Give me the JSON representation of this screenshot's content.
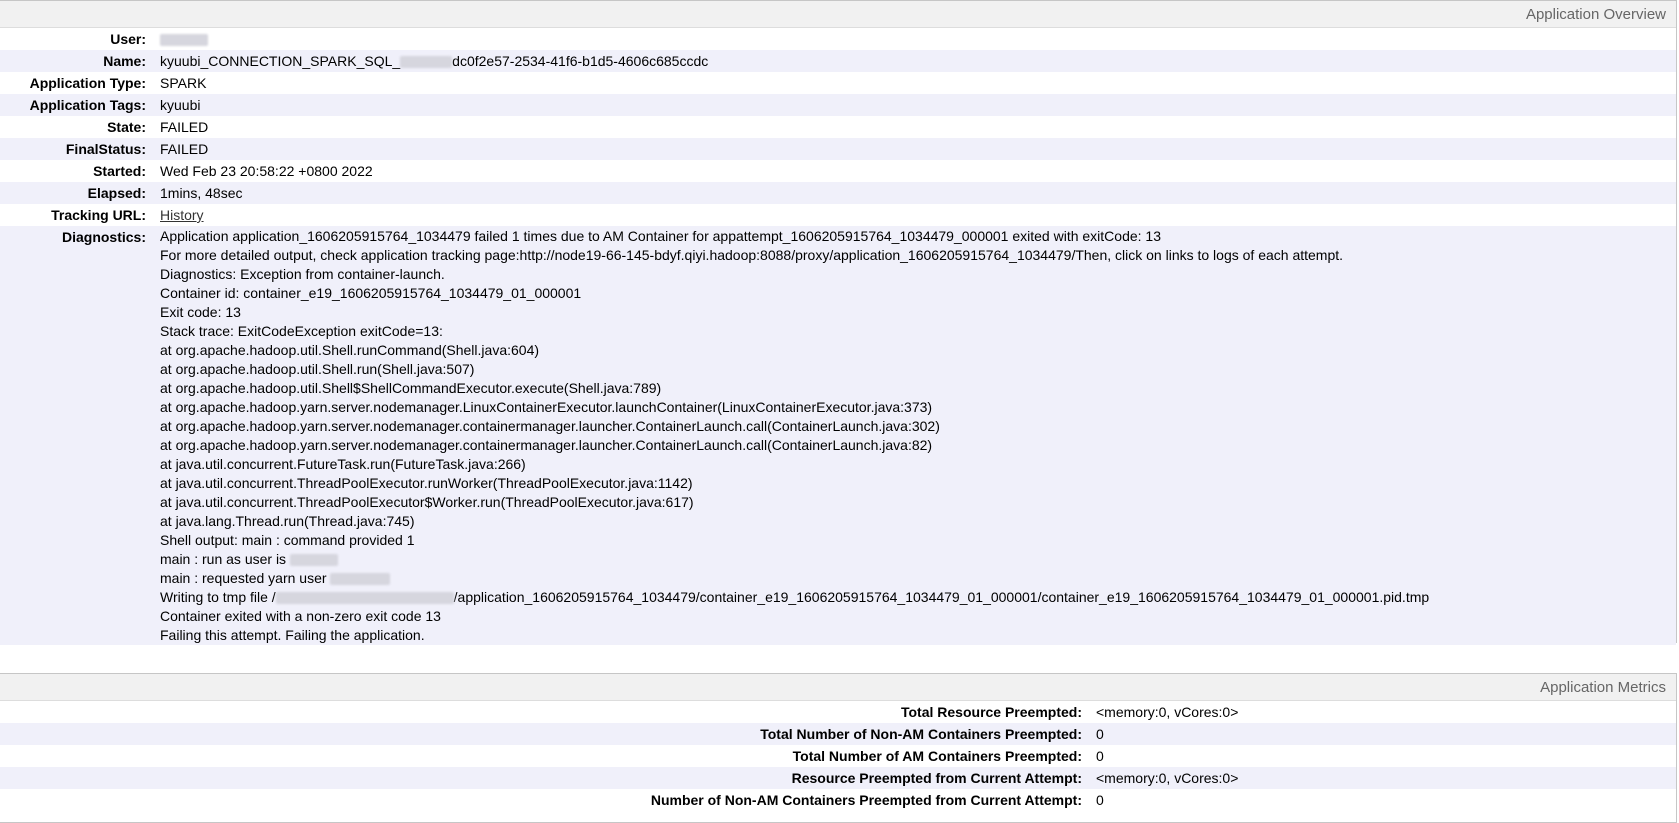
{
  "overview": {
    "title": "Application Overview",
    "user_label": "User:",
    "name_label": "Name:",
    "name_prefix": "kyuubi_CONNECTION_SPARK_SQL_",
    "name_suffix": "dc0f2e57-2534-41f6-b1d5-4606c685ccdc",
    "type_label": "Application Type:",
    "type_value": "SPARK",
    "tags_label": "Application Tags:",
    "tags_value": "kyuubi",
    "state_label": "State:",
    "state_value": "FAILED",
    "final_label": "FinalStatus:",
    "final_value": "FAILED",
    "started_label": "Started:",
    "started_value": "Wed Feb 23 20:58:22 +0800 2022",
    "elapsed_label": "Elapsed:",
    "elapsed_value": "1mins, 48sec",
    "tracking_label": "Tracking URL:",
    "tracking_value": "History",
    "diag_label": "Diagnostics:",
    "diag_lines": [
      "Application application_1606205915764_1034479 failed 1 times due to AM Container for appattempt_1606205915764_1034479_000001 exited with exitCode: 13",
      "For more detailed output, check application tracking page:http://node19-66-145-bdyf.qiyi.hadoop:8088/proxy/application_1606205915764_1034479/Then, click on links to logs of each attempt.",
      "Diagnostics: Exception from container-launch.",
      "Container id: container_e19_1606205915764_1034479_01_000001",
      "Exit code: 13",
      "Stack trace: ExitCodeException exitCode=13:",
      "at org.apache.hadoop.util.Shell.runCommand(Shell.java:604)",
      "at org.apache.hadoop.util.Shell.run(Shell.java:507)",
      "at org.apache.hadoop.util.Shell$ShellCommandExecutor.execute(Shell.java:789)",
      "at org.apache.hadoop.yarn.server.nodemanager.LinuxContainerExecutor.launchContainer(LinuxContainerExecutor.java:373)",
      "at org.apache.hadoop.yarn.server.nodemanager.containermanager.launcher.ContainerLaunch.call(ContainerLaunch.java:302)",
      "at org.apache.hadoop.yarn.server.nodemanager.containermanager.launcher.ContainerLaunch.call(ContainerLaunch.java:82)",
      "at java.util.concurrent.FutureTask.run(FutureTask.java:266)",
      "at java.util.concurrent.ThreadPoolExecutor.runWorker(ThreadPoolExecutor.java:1142)",
      "at java.util.concurrent.ThreadPoolExecutor$Worker.run(ThreadPoolExecutor.java:617)",
      "at java.lang.Thread.run(Thread.java:745)",
      "Shell output: main : command provided 1"
    ],
    "diag_run_as": "main : run as user is",
    "diag_requested": "main : requested yarn user",
    "diag_tmp_prefix": "Writing to tmp file /",
    "diag_tmp_suffix": "/application_1606205915764_1034479/container_e19_1606205915764_1034479_01_000001/container_e19_1606205915764_1034479_01_000001.pid.tmp",
    "diag_tail": [
      "Container exited with a non-zero exit code 13",
      "Failing this attempt. Failing the application."
    ]
  },
  "metrics": {
    "title": "Application Metrics",
    "rows": [
      {
        "label": "Total Resource Preempted:",
        "value": "<memory:0, vCores:0>"
      },
      {
        "label": "Total Number of Non-AM Containers Preempted:",
        "value": "0"
      },
      {
        "label": "Total Number of AM Containers Preempted:",
        "value": "0"
      },
      {
        "label": "Resource Preempted from Current Attempt:",
        "value": "<memory:0, vCores:0>"
      },
      {
        "label": "Number of Non-AM Containers Preempted from Current Attempt:",
        "value": "0"
      }
    ]
  }
}
